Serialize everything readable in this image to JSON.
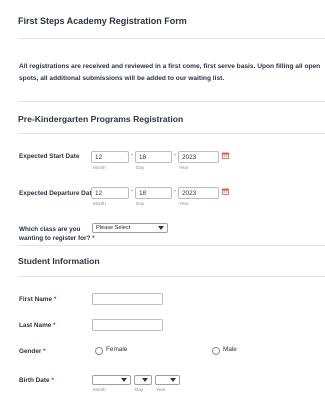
{
  "form": {
    "title": "First Steps Academy Registration Form",
    "notice": "All registrations are received and reviewed in a first come, first serve basis. Upon filling all open spots, all additional submissions will be added to our waiting list."
  },
  "section_prek": {
    "heading": "Pre-Kindergarten Programs Registration",
    "start_date": {
      "label": "Expected Start Date",
      "month": "12",
      "day": "18",
      "year": "2023",
      "month_sub": "Month",
      "day_sub": "Day",
      "year_sub": "Year"
    },
    "departure_date": {
      "label": "Expected Departure Date",
      "month": "12",
      "day": "18",
      "year": "2023",
      "month_sub": "Month",
      "day_sub": "Day",
      "year_sub": "Year"
    },
    "class_select": {
      "label_line1": "Which class are you",
      "label_line2": "wanting to register for?",
      "required": "*",
      "selected": "Please Select"
    }
  },
  "section_student": {
    "heading": "Student Information",
    "first_name": {
      "label": "First Name",
      "required": "*"
    },
    "last_name": {
      "label": "Last Name",
      "required": "*"
    },
    "gender": {
      "label": "Gender",
      "required": "*",
      "option_female": "Female",
      "option_male": "Male"
    },
    "birth_date": {
      "label": "Birth Date",
      "required": "*",
      "month_sub": "Month",
      "day_sub": "Day",
      "year_sub": "Year"
    }
  },
  "separator": "-",
  "colors": {
    "required": "#d91a1a",
    "divider": "#e3e5ea",
    "calendar": "#e0533b"
  }
}
